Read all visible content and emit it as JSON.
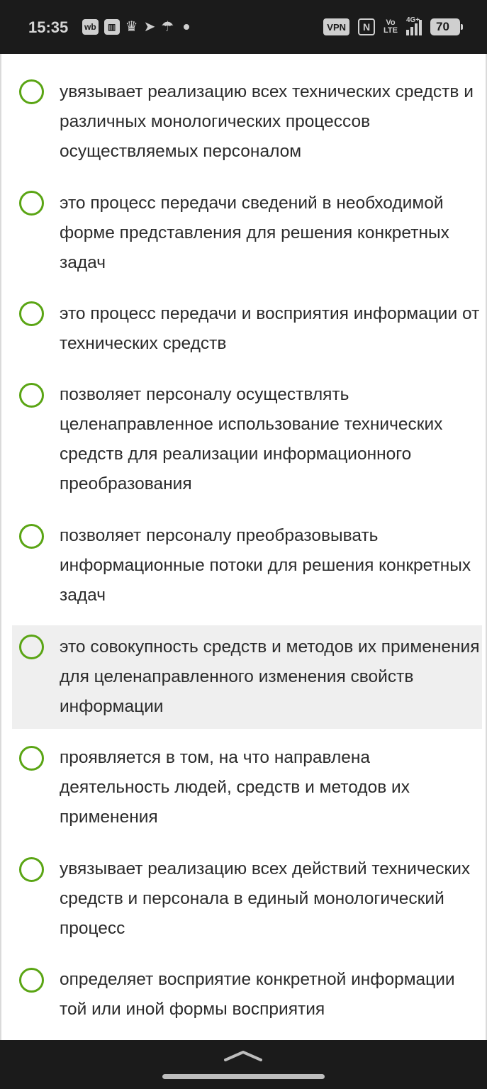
{
  "status_bar": {
    "time": "15:35",
    "left_icons": [
      "wb-app-icon",
      "wallet-app-icon",
      "gov-emblem-icon",
      "telegram-icon",
      "umbrella-icon",
      "more-dot-icon"
    ],
    "wb_label": "wb",
    "vpn_label": "VPN",
    "nfc_label": "N",
    "volte_top": "Vo",
    "volte_bottom": "LTE",
    "network_label": "4G+",
    "battery_level": "70"
  },
  "options": [
    {
      "text": "увязывает реализацию всех технических средств и различных монологических процессов осуществляемых персоналом",
      "selected": false
    },
    {
      "text": "это процесс передачи сведений в необходимой форме представления для решения конкретных задач",
      "selected": false
    },
    {
      "text": "это процесс передачи и восприятия информации от технических средств",
      "selected": false
    },
    {
      "text": "позволяет персоналу осуществлять целенаправленное использование технических средств для реализации информационного преобразования",
      "selected": false
    },
    {
      "text": "позволяет персоналу преобразовывать информационные потоки для решения конкретных задач",
      "selected": false
    },
    {
      "text": "это совокупность средств и методов их применения для целенаправленного изменения свойств информации",
      "selected": false
    },
    {
      "text": "проявляется в том, на что направлена деятельность людей, средств и методов их применения",
      "selected": false
    },
    {
      "text": "увязывает реализацию всех действий технических средств и персонала в единый монологический процесс",
      "selected": false
    },
    {
      "text": "определяет восприятие конкретной информации той или иной формы восприятия",
      "selected": false
    }
  ],
  "colors": {
    "radio_border": "#5aa514",
    "highlight_bg": "#efefef",
    "text": "#2b2b2b",
    "system_bar": "#1b1b1b"
  }
}
